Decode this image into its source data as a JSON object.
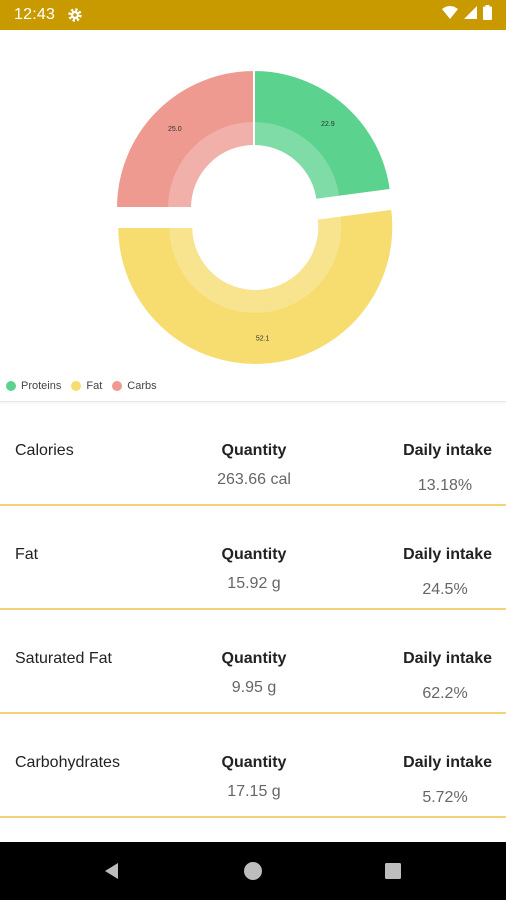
{
  "status_bar": {
    "time": "12:43",
    "background": "#c99a00",
    "icons": [
      "gear-icon",
      "wifi-icon",
      "signal-icon",
      "battery-icon"
    ]
  },
  "chart_data": {
    "type": "pie",
    "categories": [
      "Proteins",
      "Fat",
      "Carbs"
    ],
    "values": [
      22.9,
      52.1,
      25.0
    ],
    "value_labels": [
      "22.9",
      "52.1",
      "25.0"
    ],
    "colors": [
      "#5bd38f",
      "#f7dc6f",
      "#ee9a91"
    ],
    "highlighted": "Fat",
    "legend_position": "bottom-left"
  },
  "nutrients": [
    {
      "name": "Calories",
      "quantity_label": "Quantity",
      "quantity": "263.66 cal",
      "daily_label": "Daily intake",
      "daily": "13.18%"
    },
    {
      "name": "Fat",
      "quantity_label": "Quantity",
      "quantity": "15.92 g",
      "daily_label": "Daily intake",
      "daily": "24.5%"
    },
    {
      "name": "Saturated Fat",
      "quantity_label": "Quantity",
      "quantity": "9.95 g",
      "daily_label": "Daily intake",
      "daily": "62.2%"
    },
    {
      "name": "Carbohydrates",
      "quantity_label": "Quantity",
      "quantity": "17.15 g",
      "daily_label": "Daily intake",
      "daily": "5.72%"
    }
  ],
  "nav": {
    "icons": [
      "back-icon",
      "home-icon",
      "recents-icon"
    ]
  }
}
